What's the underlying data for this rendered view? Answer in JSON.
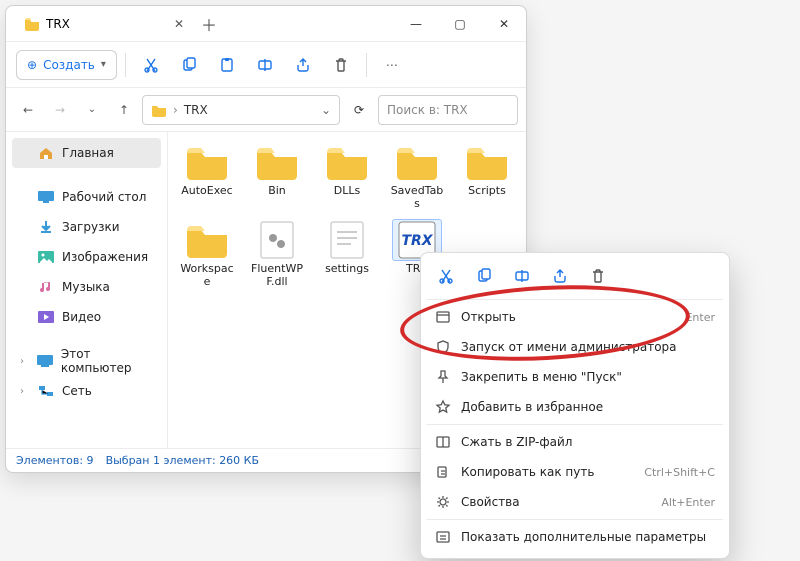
{
  "window": {
    "tab_title": "TRX",
    "new_btn": "Создать",
    "breadcrumb_root_icon": "folder",
    "breadcrumb": "TRX",
    "search_placeholder": "Поиск в: TRX"
  },
  "sidebar": {
    "home": "Главная",
    "desktop": "Рабочий стол",
    "downloads": "Загрузки",
    "pictures": "Изображения",
    "music": "Музыка",
    "videos": "Видео",
    "this_pc": "Этот компьютер",
    "network": "Сеть"
  },
  "files": {
    "autoexec": "AutoExec",
    "bin": "Bin",
    "dlls": "DLLs",
    "savedtabs": "SavedTabs",
    "scripts": "Scripts",
    "workspace": "Workspace",
    "fluentwpf": "FluentWPF.dll",
    "settings": "settings",
    "trx": "TRX"
  },
  "status": {
    "count": "Элементов: 9",
    "selection": "Выбран 1 элемент: 260 КБ"
  },
  "ctx": {
    "open": "Открыть",
    "open_sc": "Enter",
    "runas": "Запуск от имени администратора",
    "pin_start": "Закрепить в меню \"Пуск\"",
    "favorite": "Добавить в избранное",
    "zip": "Сжать в ZIP-файл",
    "copy_path": "Копировать как путь",
    "copy_path_sc": "Ctrl+Shift+C",
    "properties": "Свойства",
    "properties_sc": "Alt+Enter",
    "more": "Показать дополнительные параметры"
  }
}
